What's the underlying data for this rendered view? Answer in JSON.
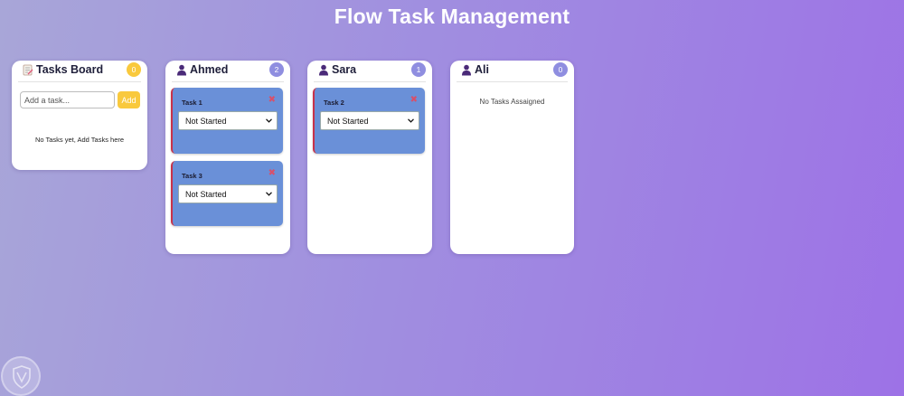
{
  "app": {
    "title": "Flow Task Management"
  },
  "colors": {
    "background_start": "#a8a6d8",
    "background_end": "#9d72e6",
    "task_card": "#6a90d8",
    "task_card_border": "#c8324a",
    "badge_yellow": "#f9c93d",
    "badge_purple": "#8f8ee0",
    "delete_red": "#d8506a"
  },
  "tasks_board": {
    "icon": "memo-icon",
    "title": "Tasks Board",
    "count": "0",
    "input_placeholder": "Add a task...",
    "add_label": "Add",
    "empty_message": "No Tasks yet, Add Tasks here"
  },
  "columns": [
    {
      "icon": "user-icon",
      "name": "Ahmed",
      "count": "2",
      "tasks": [
        {
          "name": "Task 1",
          "status": "Not Started",
          "delete_icon": "close-icon"
        },
        {
          "name": "Task 3",
          "status": "Not Started",
          "delete_icon": "close-icon"
        }
      ]
    },
    {
      "icon": "user-icon",
      "name": "Sara",
      "count": "1",
      "tasks": [
        {
          "name": "Task 2",
          "status": "Not Started",
          "delete_icon": "close-icon"
        }
      ]
    },
    {
      "icon": "user-icon",
      "name": "Ali",
      "count": "0",
      "tasks": [],
      "empty_message": "No Tasks Assaigned"
    }
  ],
  "delete_symbol": "✖",
  "watermark": {
    "icon": "shield-logo-icon"
  }
}
